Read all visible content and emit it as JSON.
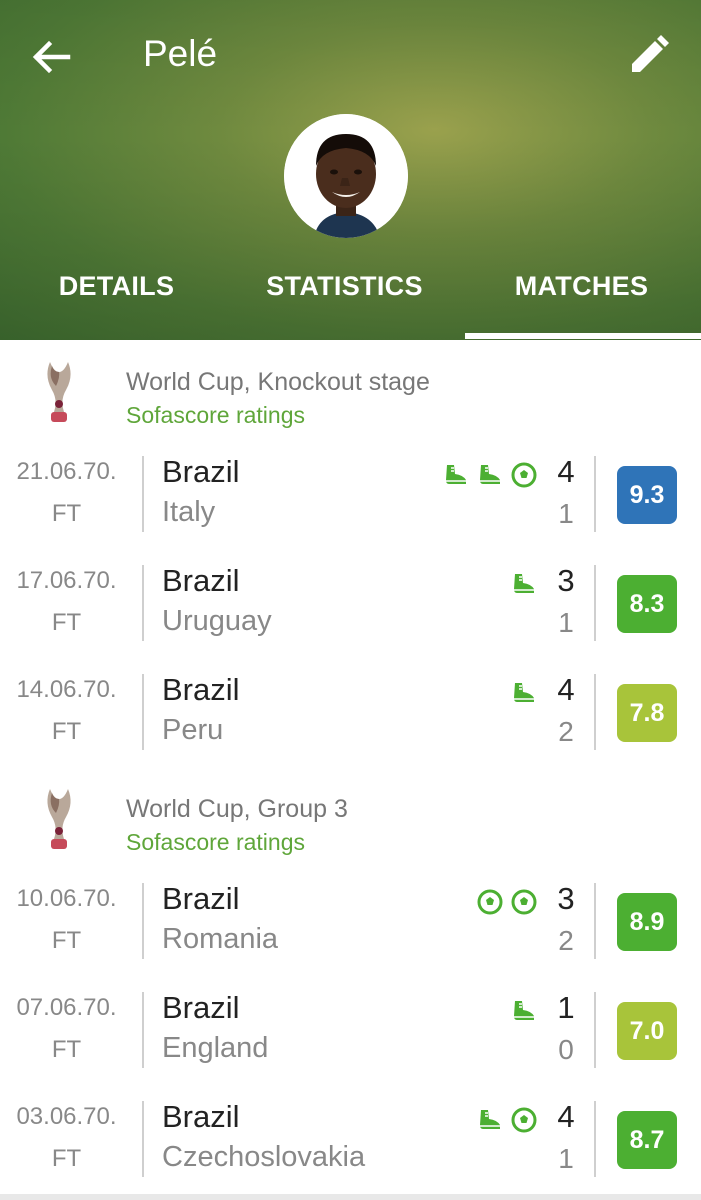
{
  "header": {
    "title": "Pelé",
    "back_icon": "arrow-left-icon",
    "edit_icon": "pencil-icon",
    "avatar": "player-photo"
  },
  "tabs": [
    {
      "label": "DETAILS",
      "active": false
    },
    {
      "label": "STATISTICS",
      "active": false
    },
    {
      "label": "MATCHES",
      "active": true
    }
  ],
  "colors": {
    "rating_blue": "#2f74b8",
    "rating_green": "#4caf32",
    "rating_lime": "#a8c43a",
    "accent_green": "#5fa63a"
  },
  "sections": [
    {
      "competition": "World Cup, Knockout stage",
      "subtitle": "Sofascore ratings",
      "icon": "world-cup-trophy-icon",
      "matches": [
        {
          "date": "21.06.70.",
          "status": "FT",
          "home": "Brazil",
          "away": "Italy",
          "home_score": "4",
          "away_score": "1",
          "events": [
            "assist-boot-icon",
            "assist-boot-icon",
            "goal-ball-icon"
          ],
          "rating": "9.3",
          "rating_color": "#2f74b8"
        },
        {
          "date": "17.06.70.",
          "status": "FT",
          "home": "Brazil",
          "away": "Uruguay",
          "home_score": "3",
          "away_score": "1",
          "events": [
            "assist-boot-icon"
          ],
          "rating": "8.3",
          "rating_color": "#4caf32"
        },
        {
          "date": "14.06.70.",
          "status": "FT",
          "home": "Brazil",
          "away": "Peru",
          "home_score": "4",
          "away_score": "2",
          "events": [
            "assist-boot-icon"
          ],
          "rating": "7.8",
          "rating_color": "#a8c43a"
        }
      ]
    },
    {
      "competition": "World Cup, Group 3",
      "subtitle": "Sofascore ratings",
      "icon": "world-cup-trophy-icon",
      "matches": [
        {
          "date": "10.06.70.",
          "status": "FT",
          "home": "Brazil",
          "away": "Romania",
          "home_score": "3",
          "away_score": "2",
          "events": [
            "goal-ball-icon",
            "goal-ball-icon"
          ],
          "rating": "8.9",
          "rating_color": "#4caf32"
        },
        {
          "date": "07.06.70.",
          "status": "FT",
          "home": "Brazil",
          "away": "England",
          "home_score": "1",
          "away_score": "0",
          "events": [
            "assist-boot-icon"
          ],
          "rating": "7.0",
          "rating_color": "#a8c43a"
        },
        {
          "date": "03.06.70.",
          "status": "FT",
          "home": "Brazil",
          "away": "Czechoslovakia",
          "home_score": "4",
          "away_score": "1",
          "events": [
            "assist-boot-icon",
            "goal-ball-icon"
          ],
          "rating": "8.7",
          "rating_color": "#4caf32"
        }
      ]
    }
  ]
}
